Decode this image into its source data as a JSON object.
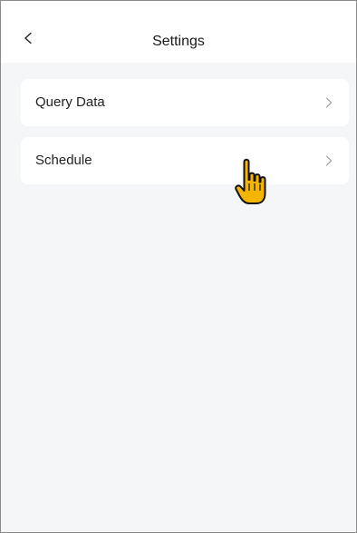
{
  "header": {
    "title": "Settings",
    "back_icon": "chevron-left-icon"
  },
  "menu": [
    {
      "label": "Query Data",
      "icon": "chevron-right-icon"
    },
    {
      "label": "Schedule",
      "icon": "chevron-right-icon"
    }
  ],
  "cursor": {
    "icon": "pointing-hand-cursor-icon",
    "color": "#F5B400"
  },
  "colors": {
    "background": "#F5F6F7",
    "card": "#FFFFFF",
    "text": "#222222",
    "chevron": "#999999"
  }
}
